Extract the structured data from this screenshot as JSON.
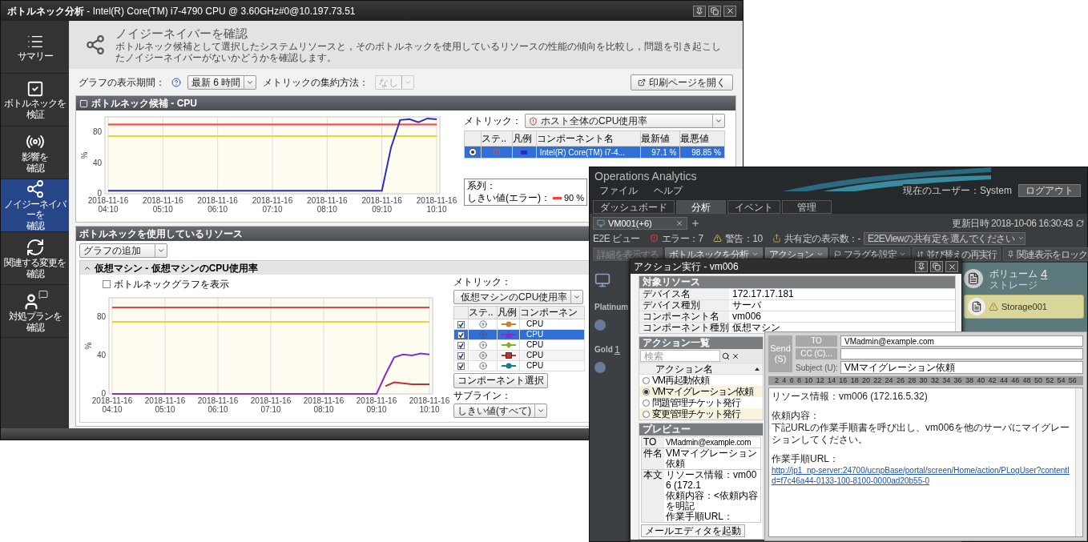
{
  "main_window": {
    "title": "**ボトルネック分析** - Intel(R) Core(TM) i7-4790 CPU @ 3.60GHz#0@10.197.73.51",
    "sidebar": [
      {
        "lines": [
          "サマリー"
        ],
        "kind": "list",
        "selected": false
      },
      {
        "lines": [
          "ボトルネックを",
          "検証"
        ],
        "kind": "check",
        "selected": false
      },
      {
        "lines": [
          "影響を",
          "確認"
        ],
        "kind": "signal",
        "selected": false
      },
      {
        "lines": [
          "ノイジーネイバーを",
          "確認"
        ],
        "kind": "network",
        "selected": true
      },
      {
        "lines": [
          "関連する変更を",
          "確認"
        ],
        "kind": "sync",
        "selected": false
      },
      {
        "lines": [
          "対処プランを",
          "確認"
        ],
        "kind": "advisor",
        "selected": false
      }
    ],
    "header": {
      "title": "ノイジーネイバーを確認",
      "description": "ボトルネック候補として選択したシステムリソースと，そのボトルネックを使用しているリソースの性能の傾向を比較し，問題を引き起こしたノイジーネイバーがないかどうかを確認します。"
    },
    "toolbar": {
      "period_label": "グラフの表示期間：",
      "period": "最新 6 時間",
      "aggregate_label": "メトリックの集約方法：",
      "aggregate": "なし",
      "aggregate_disabled": true,
      "print_button": "印刷ページを開く"
    },
    "bottleneck_panel": {
      "title": "ボトルネック候補 - CPU",
      "chart_data": {
        "type": "line",
        "ylabel": "%",
        "ylim": [
          0,
          100
        ],
        "yticks": [
          0,
          40,
          80
        ],
        "grid": true,
        "categories": [
          "2018-11-16 04:10",
          null,
          null,
          null,
          null,
          null,
          "2018-11-16 05:10",
          null,
          null,
          null,
          null,
          null,
          "2018-11-16 06:10",
          null,
          null,
          null,
          null,
          null,
          "2018-11-16 07:10",
          null,
          null,
          null,
          null,
          null,
          "2018-11-16 08:10",
          null,
          null,
          null,
          null,
          null,
          "2018-11-16 09:10",
          null,
          null,
          null,
          null,
          null,
          "2018-11-16 10:10"
        ],
        "series": [
          {
            "color": "#ff3b3b",
            "values": [
              90,
              90,
              90,
              90,
              90,
              90,
              90,
              90,
              90,
              90,
              90,
              90,
              90,
              90,
              90,
              90,
              90,
              90,
              90,
              90,
              90,
              90,
              90,
              90,
              90,
              90,
              90,
              90,
              90,
              90,
              90,
              90,
              90,
              90,
              90,
              90,
              90
            ]
          },
          {
            "color": "#f2d230",
            "values": [
              75,
              75,
              75,
              75,
              75,
              75,
              75,
              75,
              75,
              75,
              75,
              75,
              75,
              75,
              75,
              75,
              75,
              75,
              75,
              75,
              75,
              75,
              75,
              75,
              75,
              75,
              75,
              75,
              75,
              75,
              75,
              75,
              75,
              75,
              75,
              75,
              75
            ]
          },
          {
            "color": "#2b2bc8",
            "values": [
              4,
              4,
              4,
              4,
              4,
              4,
              4,
              4,
              4,
              4,
              4,
              4,
              4,
              4,
              4,
              4,
              4,
              4,
              4,
              4,
              4,
              4,
              4,
              4,
              4,
              4,
              4,
              4,
              4,
              4,
              4,
              60,
              96,
              97,
              93,
              98,
              97
            ]
          }
        ]
      },
      "metric_label": "メトリック：",
      "metric": "ホスト全体のCPU使用率",
      "columns": [
        "ステ..",
        "凡例",
        "コンポーネント名",
        "最新値",
        "最悪値"
      ],
      "rows": [
        {
          "selected": true,
          "color": "#2b2bc8",
          "component": "Intel(R) Core(TM) i7-4...",
          "latest": "97.1 %",
          "worst": "98.85 %"
        }
      ],
      "legend": {
        "title": "系列：",
        "items": [
          {
            "label": "しきい値(エラー)：",
            "value": "90 %",
            "color": "#ff3b3b"
          }
        ]
      }
    },
    "resources_panel": {
      "title": "ボトルネックを使用しているリソース",
      "add_graph": "グラフの追加",
      "sub_title": "仮想マシン - 仮想マシンのCPU使用率",
      "expanded": true,
      "show_bottleneck": {
        "label": "ボトルネックグラフを表示",
        "checked": false
      },
      "chart_data": {
        "type": "line",
        "ylabel": "%",
        "ylim": [
          0,
          100
        ],
        "yticks": [
          0,
          40,
          80
        ],
        "grid": true,
        "categories": [
          "2018-11-16 04:10",
          null,
          null,
          null,
          null,
          null,
          "2018-11-16 05:10",
          null,
          null,
          null,
          null,
          null,
          "2018-11-16 06:10",
          null,
          null,
          null,
          null,
          null,
          "2018-11-16 07:10",
          null,
          null,
          null,
          null,
          null,
          "2018-11-16 08:10",
          null,
          null,
          null,
          null,
          null,
          "2018-11-16 09:10",
          null,
          null,
          null,
          null,
          null,
          "2018-11-16 10:10"
        ],
        "series": [
          {
            "color": "#ff3b3b",
            "values": [
              90,
              90,
              90,
              90,
              90,
              90,
              90,
              90,
              90,
              90,
              90,
              90,
              90,
              90,
              90,
              90,
              90,
              90,
              90,
              90,
              90,
              90,
              90,
              90,
              90,
              90,
              90,
              90,
              90,
              90,
              90,
              90,
              90,
              90,
              90,
              90,
              90
            ]
          },
          {
            "color": "#f2d230",
            "values": [
              75,
              75,
              75,
              75,
              75,
              75,
              75,
              75,
              75,
              75,
              75,
              75,
              75,
              75,
              75,
              75,
              75,
              75,
              75,
              75,
              75,
              75,
              75,
              75,
              75,
              75,
              75,
              75,
              75,
              75,
              75,
              75,
              75,
              75,
              75,
              75,
              75
            ]
          },
          {
            "color": "#c03030",
            "values": [
              null,
              null,
              null,
              null,
              null,
              null,
              null,
              null,
              null,
              null,
              null,
              null,
              null,
              null,
              null,
              null,
              null,
              null,
              null,
              null,
              null,
              null,
              null,
              null,
              null,
              null,
              null,
              null,
              null,
              null,
              null,
              8,
              12,
              11,
              10,
              10,
              10
            ]
          },
          {
            "color": "#8a2bd0",
            "values": [
              0,
              0,
              0,
              0,
              0,
              0,
              0,
              0,
              0,
              0,
              0,
              0,
              0,
              0,
              0,
              0,
              0,
              0,
              0,
              0,
              0,
              0,
              0,
              0,
              0,
              0,
              0,
              0,
              0,
              0,
              0,
              20,
              38,
              41,
              40,
              42,
              41
            ]
          }
        ]
      },
      "metric_label": "メトリック：",
      "metric": "仮想マシンのCPU使用率",
      "columns": [
        "ステ..",
        "凡例",
        "コンポーネン"
      ],
      "rows": [
        {
          "checked": true,
          "selected": false,
          "kind": "circle",
          "color": "#c8862a",
          "component": "CPU"
        },
        {
          "checked": true,
          "selected": true,
          "kind": "triangle",
          "color": "#8a2bd0",
          "component": "CPU"
        },
        {
          "checked": true,
          "selected": false,
          "kind": "diamond",
          "color": "#88b020",
          "component": "CPU"
        },
        {
          "checked": true,
          "selected": false,
          "kind": "square",
          "color": "#c03030",
          "component": "CPU"
        },
        {
          "checked": true,
          "selected": false,
          "kind": "circle",
          "color": "#108080",
          "component": "CPU"
        }
      ],
      "component_select": "コンポーネント選択",
      "subline_label": "サブライン：",
      "subline": "しきい値(すべて)"
    }
  },
  "analytics_window": {
    "title": "Operations Analytics",
    "menu": [
      "ファイル",
      "ヘルプ"
    ],
    "user": "現在のユーザー：System",
    "logout": "ログアウト",
    "tabs": [
      {
        "label": "ダッシュボード",
        "selected": false
      },
      {
        "label": "分析",
        "selected": true
      },
      {
        "label": "イベント",
        "selected": false
      },
      {
        "label": "管理",
        "selected": false
      }
    ],
    "doc_tab": "VM001(+6)",
    "status": {
      "view": "E2E ビュー",
      "errors": "エラー：7",
      "warnings": "警告：10",
      "shared_label": "共有定の表示数：-",
      "shared_select": "E2EViewの共有定を選んでください",
      "updated": "更新日時 2018-10-06 16:30:43"
    },
    "actions": [
      {
        "label": "詳細を表示する",
        "kind": "button",
        "disabled": true
      },
      {
        "label": "ボトルネックを分析",
        "kind": "dropdown",
        "disabled": false
      },
      {
        "label": "アクション",
        "kind": "dropdown",
        "disabled": false
      }
    ],
    "right_actions": [
      {
        "label": "フラグを設定",
        "kind": "flag"
      },
      {
        "label": "並び替えの再実行",
        "kind": "sort"
      },
      {
        "label": "関連表示をロック",
        "kind": "pin"
      }
    ],
    "canvas": {
      "groups": [
        {
          "label": "Platinum"
        },
        {
          "label": "Gold",
          "rank": "1"
        }
      ],
      "volume": {
        "label": "ボリューム",
        "count": "4",
        "sub": "ストレージ"
      },
      "storage": "Storage001"
    }
  },
  "action_dialog": {
    "title": "アクション実行 - vm006",
    "target": {
      "title": "対象リソース",
      "rows": [
        {
          "label": "デバイス名",
          "value": "172.17.17.181"
        },
        {
          "label": "デバイス種別",
          "value": "サーバ"
        },
        {
          "label": "コンポーネント名",
          "value": "vm006"
        },
        {
          "label": "コンポーネント種別",
          "value": "仮想マシン"
        }
      ]
    },
    "action_list": {
      "title": "アクション一覧",
      "search_placeholder": "検索",
      "column": "アクション名",
      "items": [
        {
          "label": "VM再起動依頼",
          "selected": false
        },
        {
          "label": "VMマイグレーション依頼",
          "selected": true
        },
        {
          "label": "問題管理チケット発行",
          "selected": false
        },
        {
          "label": "変更管理チケット発行",
          "selected": false
        }
      ]
    },
    "preview": {
      "title": "プレビュー",
      "rows": [
        {
          "label": "TO",
          "value": "VMadmin@example.com"
        },
        {
          "label": "件名",
          "value": "VMマイグレーション依頼"
        },
        {
          "label": "本文",
          "lines": [
            "リソース情報：vm006 (172.1",
            "依頼内容：<依頼内容を明記",
            "作業手順URL："
          ]
        }
      ],
      "launch_button": "メールエディタを起動"
    }
  },
  "mail_editor": {
    "send": "Send (S)",
    "to_button": "TO",
    "to": "VMadmin@example.com",
    "cc_button": "CC (C)...",
    "subject_label": "Subject (U):",
    "subject": "VMマイグレーション依頼",
    "ruler": [
      "2",
      "4",
      "6",
      "8",
      "10",
      "12",
      "14",
      "16",
      "18",
      "20",
      "22",
      "24",
      "26",
      "28",
      "30",
      "32",
      "34",
      "36",
      "38",
      "40",
      "42",
      "44",
      "46",
      "48",
      "50",
      "52",
      "54",
      "56"
    ],
    "paragraphs": [
      [
        "リソース情報：vm006 (172.16.5.32)"
      ],
      [
        "依頼内容：",
        "下記URLの作業手順書を呼び出し、vm006を他のサーバにマイグレーションしてください。"
      ],
      [
        "作業手順URL："
      ]
    ],
    "link": "http://jp1_np-server:24700/ucnpBase/portal/screen/Home/action/PLogUser?contentId=f7c46a44-0133-100-8100-0000ad20b55-0"
  }
}
